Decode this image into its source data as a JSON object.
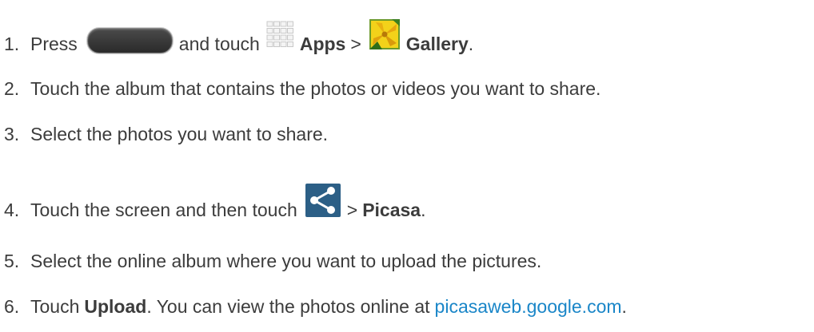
{
  "steps": [
    {
      "num": "1.",
      "press": "Press",
      "and_touch": "and touch",
      "apps": "Apps",
      "sep": ">",
      "gallery": "Gallery",
      "period": "."
    },
    {
      "num": "2.",
      "text": "Touch the album that contains the photos or videos you want to share."
    },
    {
      "num": "3.",
      "text": "Select the photos you want to share."
    },
    {
      "num": "4.",
      "text": "Touch the screen and then touch",
      "sep": ">",
      "picasa": "Picasa",
      "period": "."
    },
    {
      "num": "5.",
      "text": "Select the online album where you want to upload the pictures."
    },
    {
      "num": "6.",
      "touch": "Touch",
      "upload": "Upload",
      "text": ". You can view the photos online at",
      "link": "picasaweb.google.com",
      "period": "."
    }
  ],
  "icons": {
    "home_button": "home-button-icon",
    "apps": "apps-grid-icon",
    "gallery": "gallery-icon",
    "share": "share-icon"
  },
  "colors": {
    "text": "#3c3c3c",
    "link": "#1a86c8",
    "share_icon_bg": "#2c5f86"
  }
}
